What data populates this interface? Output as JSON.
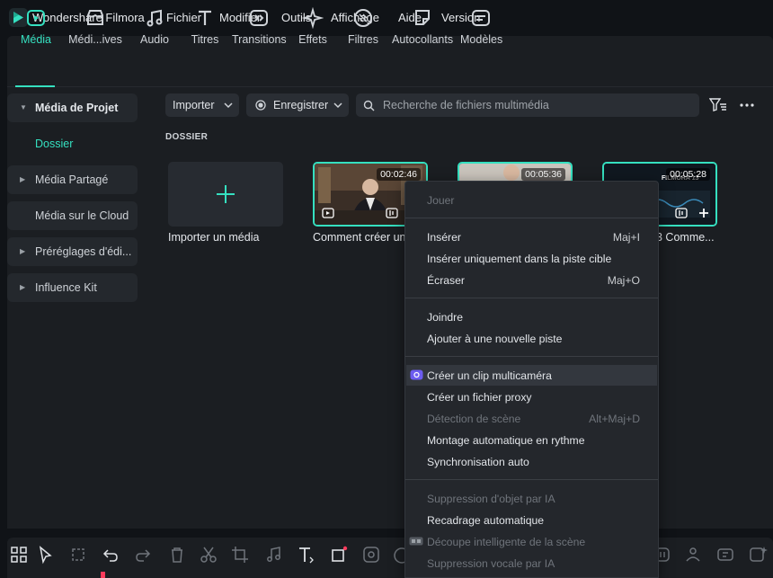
{
  "app": {
    "title": "Wondershare Filmora"
  },
  "menu": [
    "Fichier",
    "Modifier",
    "Outils",
    "Affichage",
    "Aide",
    "Version"
  ],
  "toolbar": {
    "tabs": [
      "Média",
      "Médi...ives",
      "Audio",
      "Titres",
      "Transitions",
      "Effets",
      "Filtres",
      "Autocollants",
      "Modèles"
    ],
    "active_index": 0
  },
  "sidebar": {
    "project_media": "Média de Projet",
    "folder": "Dossier",
    "shared_media": "Média Partagé",
    "cloud_media": "Média sur le Cloud",
    "presets": "Préréglages d'édi...",
    "influence_kit": "Influence Kit"
  },
  "content": {
    "import_label": "Importer",
    "record_label": "Enregistrer",
    "search_placeholder": "Recherche de fichiers multimédia",
    "section_label": "DOSSIER",
    "import_media_label": "Importer un média",
    "clips": [
      {
        "duration": "00:02:46",
        "label": "Comment créer un"
      },
      {
        "duration": "00:05:36",
        "label": ""
      },
      {
        "duration": "00:05:28",
        "label": "3  Comme...",
        "badge_text": "FILMORA 13"
      }
    ]
  },
  "context_menu": {
    "play": "Jouer",
    "insert": "Insérer",
    "insert_shortcut": "Maj+I",
    "insert_target": "Insérer uniquement dans la piste cible",
    "overwrite": "Écraser",
    "overwrite_shortcut": "Maj+O",
    "join": "Joindre",
    "add_track": "Ajouter à une nouvelle piste",
    "multicam": "Créer un clip multicaméra",
    "proxy": "Créer un fichier proxy",
    "scene_detect": "Détection de scène",
    "scene_detect_shortcut": "Alt+Maj+D",
    "beat_sync": "Montage automatique en rythme",
    "auto_sync": "Synchronisation auto",
    "ai_object_removal": "Suppression d'objet par IA",
    "auto_reframe": "Recadrage automatique",
    "smart_scene_cut": "Découpe intelligente de la scène",
    "ai_vocal_removal": "Suppression vocale par IA"
  },
  "colors": {
    "accent": "#35e0c0",
    "record_dot": "#ff3b5c"
  }
}
